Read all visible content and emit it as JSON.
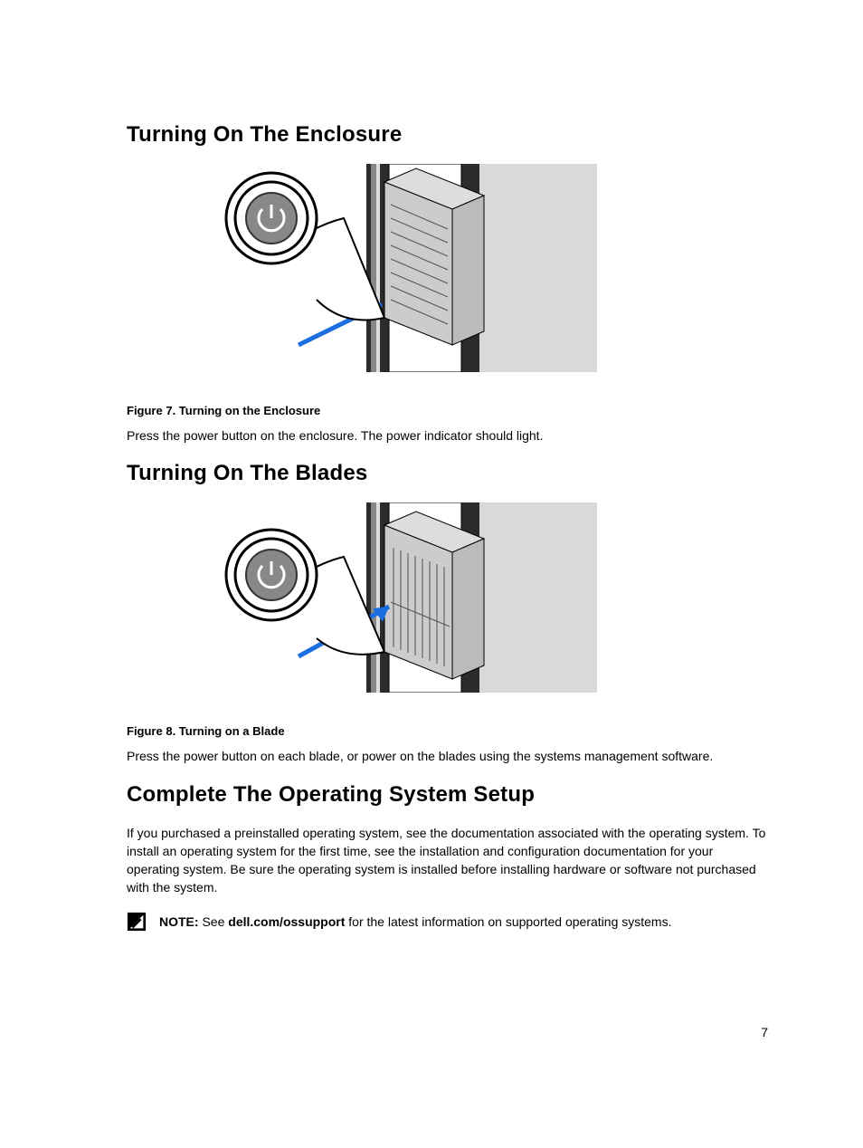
{
  "section1": {
    "heading": "Turning On The Enclosure",
    "fig_caption": "Figure 7. Turning on the Enclosure",
    "body": "Press the power button on the enclosure. The power indicator should light."
  },
  "section2": {
    "heading": "Turning On The Blades",
    "fig_caption": "Figure 8. Turning on a Blade",
    "body": "Press the power button on each blade, or power on the blades using the systems management software."
  },
  "section3": {
    "heading": "Complete The Operating System Setup",
    "body": "If you purchased a preinstalled operating system, see the documentation associated with the operating system. To install an operating system for the first time, see the installation and configuration documentation for your operating system. Be sure the operating system is installed before installing hardware or software not purchased with the system.",
    "note_label": "NOTE:",
    "note_pre": " See ",
    "note_bold": "dell.com/ossupport",
    "note_post": " for the latest information on supported operating systems."
  },
  "page_number": "7"
}
